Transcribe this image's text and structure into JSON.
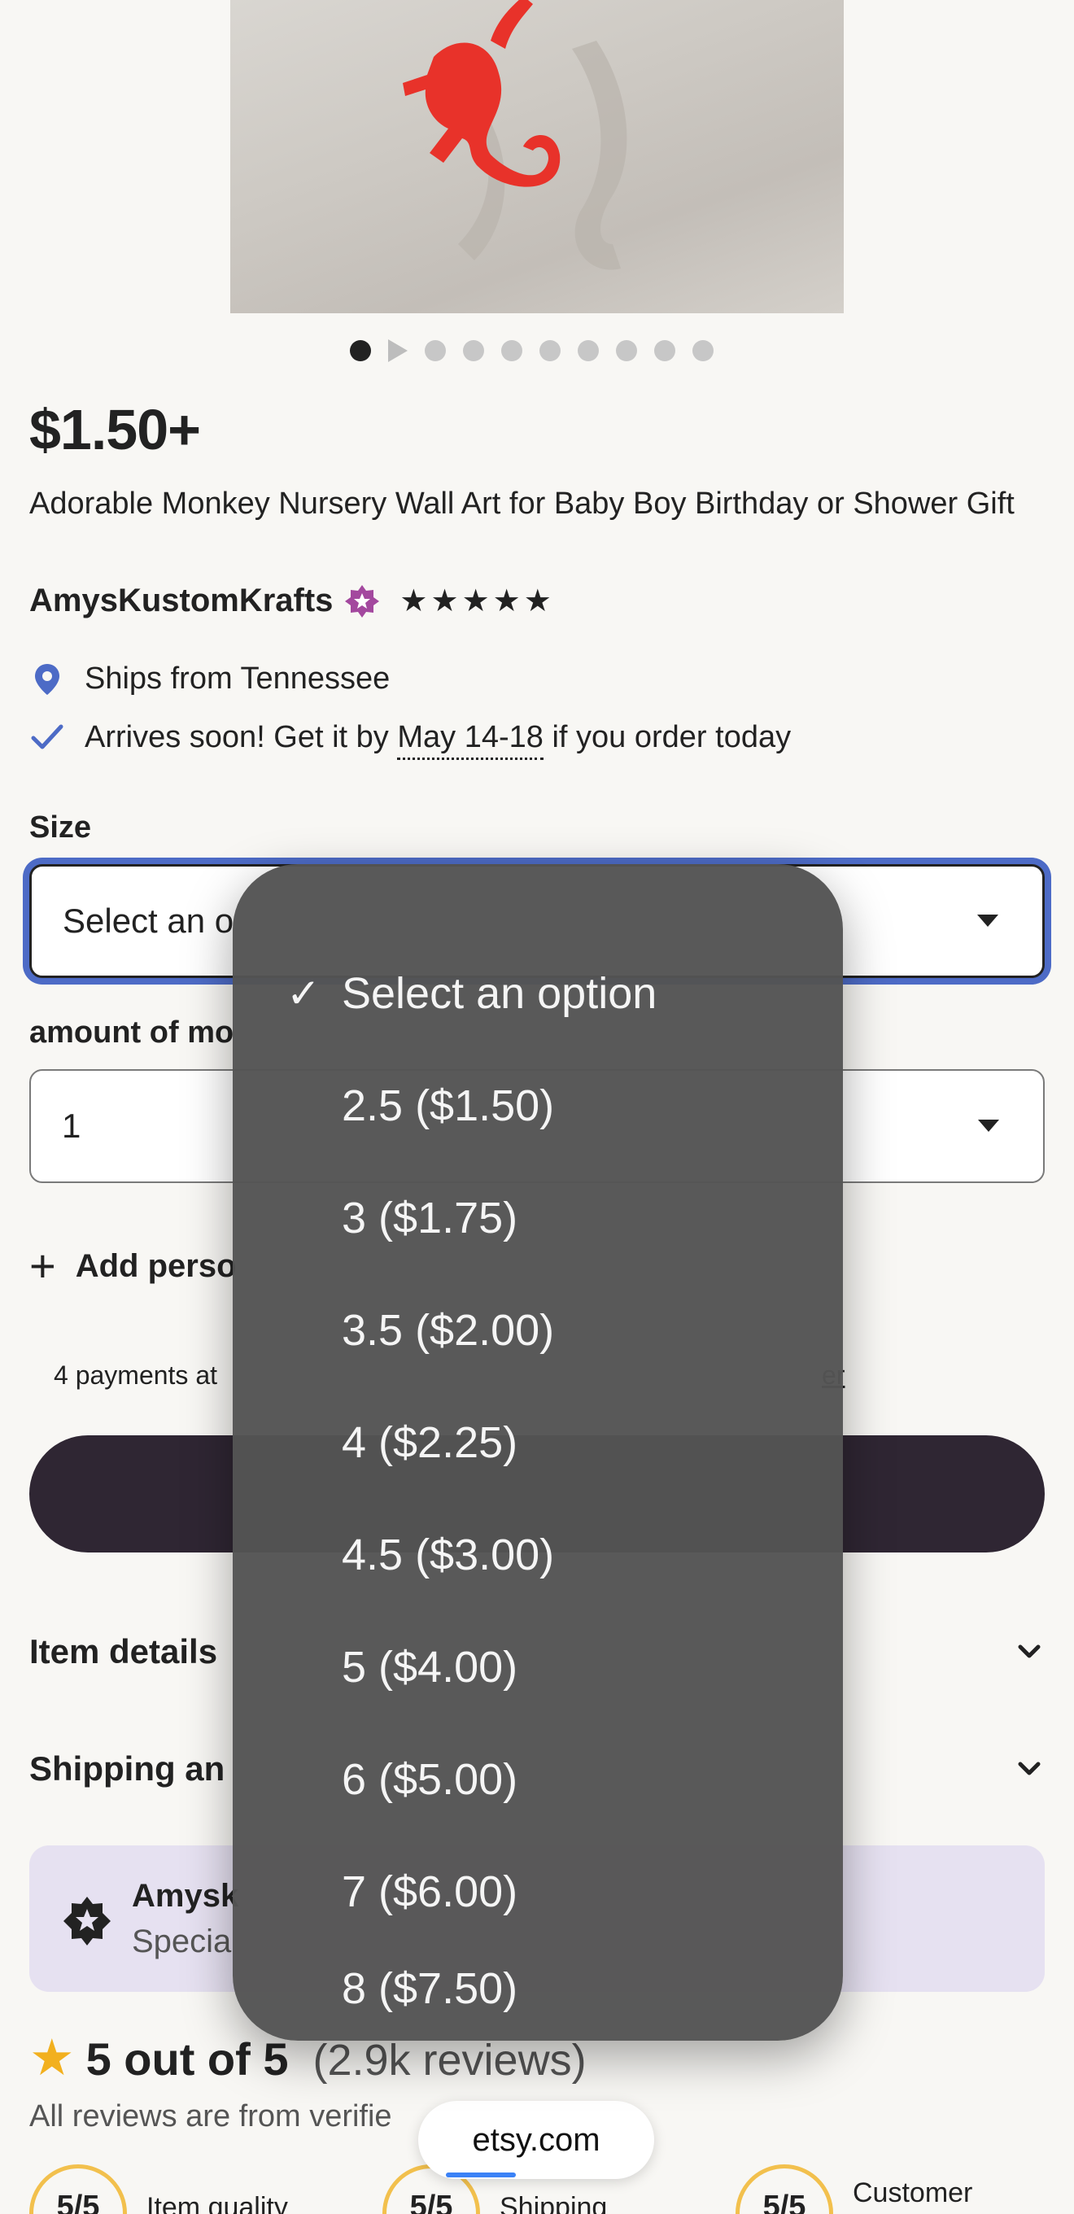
{
  "product": {
    "price": "$1.50+",
    "title": "Adorable Monkey Nursery Wall Art for Baby Boy Birthday or Shower Gift",
    "shop_name": "AmysKustomKrafts",
    "stars": [
      "★",
      "★",
      "★",
      "★",
      "★"
    ],
    "ships_from": "Ships from Tennessee",
    "arrives_prefix": "Arrives soon! Get it by",
    "arrives_date": "May 14-18",
    "arrives_suffix": "if you order today"
  },
  "carousel": {
    "total_dots": 10,
    "active_index": 0
  },
  "size": {
    "label": "Size",
    "value": "Select an o"
  },
  "amount": {
    "label": "amount of mo",
    "value": "1"
  },
  "add_personalization": {
    "icon": "plus-icon",
    "label": "Add perso"
  },
  "payments": {
    "text": "4 payments at",
    "link": "er"
  },
  "accordions": [
    {
      "label": "Item details"
    },
    {
      "label": "Shipping an"
    }
  ],
  "shop_banner": {
    "name": "Amysk",
    "subtitle": "Specia"
  },
  "reviews": {
    "rating": "5 out of 5",
    "count": "(2.9k reviews)",
    "note": "All reviews are from verifie",
    "scores": [
      {
        "value": "5/5",
        "label": "Item quality"
      },
      {
        "value": "5/5",
        "label": "Shipping"
      },
      {
        "value": "5/5",
        "label": "Customer"
      }
    ]
  },
  "browser": {
    "url": "etsy.com"
  },
  "dropdown": {
    "selected_index": 0,
    "options": [
      "Select an option",
      "2.5 ($1.50)",
      "3 ($1.75)",
      "3.5 ($2.00)",
      "4 ($2.25)",
      "4.5 ($3.00)",
      "5 ($4.00)",
      "6 ($5.00)",
      "7 ($6.00)",
      "8 ($7.50)"
    ]
  },
  "colors": {
    "accent_blue": "#4d6bc6",
    "buy_button": "#2f2633",
    "star_gold": "#f2b01e",
    "star_seller_purple": "#a3489e",
    "banner_bg": "#e6e1f1"
  }
}
